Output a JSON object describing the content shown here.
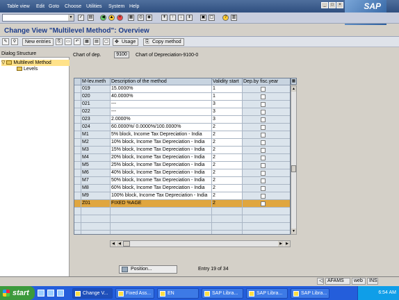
{
  "menu": {
    "items": [
      "Table view",
      "Edit",
      "Goto",
      "Choose",
      "Utilities",
      "System",
      "Help"
    ]
  },
  "brand": {
    "logo_text": "SAP"
  },
  "title": "Change View \"Multilevel Method\": Overview",
  "toolbar": {
    "new_entries": "New entries",
    "usage": "Usage",
    "copy_method": "Copy method"
  },
  "dialog": {
    "header": "Dialog Structure",
    "items": [
      {
        "label": "Multilevel Method",
        "selected": true
      },
      {
        "label": "Levels",
        "selected": false
      }
    ]
  },
  "chart_of_dep": {
    "label": "Chart of dep.",
    "value": "9100",
    "description": "Chart of Depreciation-9100-0"
  },
  "table": {
    "columns": [
      "M-lev.meth",
      "Description of the method",
      "Validity start",
      "Dep.by fisc.year"
    ],
    "rows": [
      {
        "m": "019",
        "desc": "15.0000%",
        "vs": "1",
        "dep": false
      },
      {
        "m": "020",
        "desc": "40.0000%",
        "vs": "1",
        "dep": false
      },
      {
        "m": "021",
        "desc": "---",
        "vs": "3",
        "dep": false
      },
      {
        "m": "022",
        "desc": "---",
        "vs": "3",
        "dep": false
      },
      {
        "m": "023",
        "desc": "2.0000%",
        "vs": "3",
        "dep": false
      },
      {
        "m": "024",
        "desc": "60.0000%/ 0.0000%/100.0000%",
        "vs": "2",
        "dep": false
      },
      {
        "m": "M1",
        "desc": "5% block, Income Tax Depreciation - India",
        "vs": "2",
        "dep": false
      },
      {
        "m": "M2",
        "desc": "10% block, Income Tax Depreciation - India",
        "vs": "2",
        "dep": false
      },
      {
        "m": "M3",
        "desc": "15% block, Income Tax Depreciation - India",
        "vs": "2",
        "dep": false
      },
      {
        "m": "M4",
        "desc": "20% block, Income Tax Depreciation - India",
        "vs": "2",
        "dep": false
      },
      {
        "m": "M5",
        "desc": "25% block, Income Tax Depreciation - India",
        "vs": "2",
        "dep": false
      },
      {
        "m": "M6",
        "desc": "40% block, Income Tax Depreciation - India",
        "vs": "2",
        "dep": false
      },
      {
        "m": "M7",
        "desc": "50% block, Income Tax Depreciation - India",
        "vs": "2",
        "dep": false
      },
      {
        "m": "M8",
        "desc": "60% block, Income Tax Depreciation - India",
        "vs": "2",
        "dep": false
      },
      {
        "m": "M9",
        "desc": "100% block, Income Tax Depreciation - India",
        "vs": "2",
        "dep": false
      },
      {
        "m": "Z01",
        "desc": "FIXED %AGE",
        "vs": "2",
        "dep": false,
        "highlight": true
      }
    ],
    "empty_rows": 4
  },
  "position_button": "Position...",
  "entry_info": "Entry 19 of 34",
  "status": {
    "system": "AFAMS",
    "client": "web",
    "mode": "INS"
  },
  "taskbar": {
    "start": "start",
    "tasks": [
      "Change V...",
      "Fixed Ass...",
      "EN",
      "SAP Libra...",
      "SAP Libra...",
      "SAP Libra..."
    ],
    "clock": "6:54 AM"
  }
}
